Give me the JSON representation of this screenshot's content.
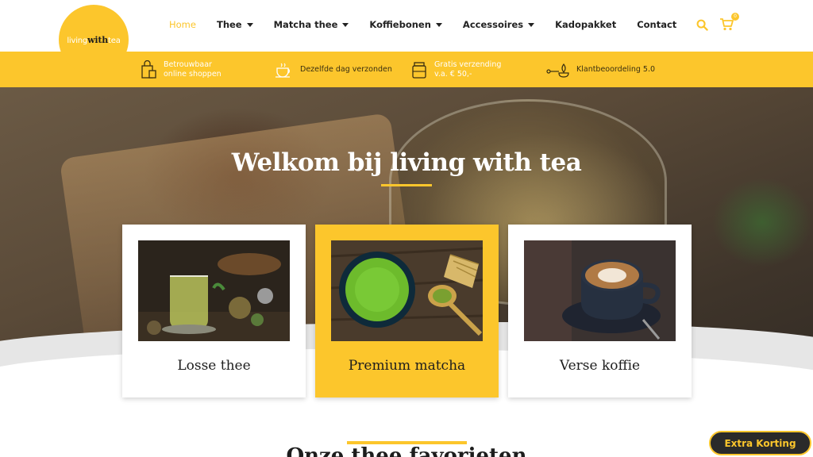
{
  "brand": {
    "logo_text_pre": "living",
    "logo_text_bold": "with",
    "logo_text_post": "tea",
    "accent_color": "#fcc62c"
  },
  "nav": {
    "items": [
      {
        "label": "Home",
        "active": true,
        "has_dropdown": false
      },
      {
        "label": "Thee",
        "active": false,
        "has_dropdown": true
      },
      {
        "label": "Matcha thee",
        "active": false,
        "has_dropdown": true
      },
      {
        "label": "Koffiebonen",
        "active": false,
        "has_dropdown": true
      },
      {
        "label": "Accessoires",
        "active": false,
        "has_dropdown": true
      },
      {
        "label": "Kadopakket",
        "active": false,
        "has_dropdown": false
      },
      {
        "label": "Contact",
        "active": false,
        "has_dropdown": false
      }
    ],
    "cart_count": "0",
    "icons": [
      "search-icon",
      "cart-icon"
    ]
  },
  "benefits": [
    {
      "icon": "shopping-bag-icon",
      "line1": "Betrouwbaar",
      "line2": "online shoppen"
    },
    {
      "icon": "teacup-icon",
      "line1": "Dezelfde dag verzonden",
      "line2": ""
    },
    {
      "icon": "tea-jar-icon",
      "line1": "Gratis verzending",
      "line2": "v.a. € 50,-"
    },
    {
      "icon": "leaf-rating-icon",
      "line1": "Klantbeoordeling 5.0",
      "line2": ""
    }
  ],
  "hero": {
    "title": "Welkom bij living with tea"
  },
  "cards": [
    {
      "label": "Losse thee",
      "image": "loose-tea-photo"
    },
    {
      "label": "Premium matcha",
      "image": "matcha-photo"
    },
    {
      "label": "Verse koffie",
      "image": "coffee-photo"
    }
  ],
  "section": {
    "title": "Onze thee favorieten"
  },
  "floating": {
    "extra_label": "Extra Korting"
  }
}
